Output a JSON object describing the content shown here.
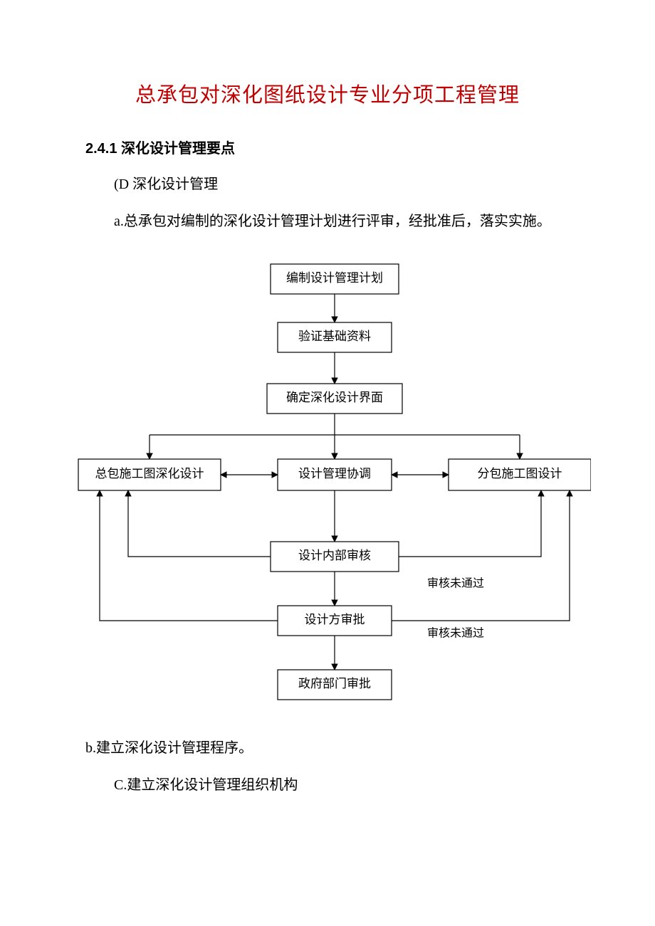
{
  "title": "总承包对深化图纸设计专业分项工程管理",
  "section_heading": "2.4.1 深化设计管理要点",
  "p_d": "(D 深化设计管理",
  "p_a": "a.总承包对编制的深化设计管理计划进行评审，经批准后，落实实施。",
  "p_b": "b.建立深化设计管理程序。",
  "p_c": "C.建立深化设计管理组织机构",
  "chart_data": {
    "type": "flowchart",
    "nodes": {
      "n1": "编制设计管理计划",
      "n2": "验证基础资料",
      "n3": "确定深化设计界面",
      "n4": "总包施工图深化设计",
      "n5": "设计管理协调",
      "n6": "分包施工图设计",
      "n7": "设计内部审核",
      "n8": "设计方审批",
      "n9": "政府部门审批"
    },
    "edge_labels": {
      "fail1": "审核未通过",
      "fail2": "审核未通过"
    },
    "edges": [
      {
        "from": "n1",
        "to": "n2"
      },
      {
        "from": "n2",
        "to": "n3"
      },
      {
        "from": "n3",
        "to": "n4"
      },
      {
        "from": "n3",
        "to": "n5"
      },
      {
        "from": "n3",
        "to": "n6"
      },
      {
        "from": "n5",
        "to": "n4",
        "bidir": true
      },
      {
        "from": "n5",
        "to": "n6",
        "bidir": true
      },
      {
        "from": "n5",
        "to": "n7"
      },
      {
        "from": "n7",
        "to": "n8"
      },
      {
        "from": "n8",
        "to": "n9"
      },
      {
        "from": "n7",
        "to": "n4",
        "label": "fail1_left"
      },
      {
        "from": "n7",
        "to": "n6",
        "label": "fail1_right"
      },
      {
        "from": "n8",
        "to": "n4",
        "label": "fail2_left"
      },
      {
        "from": "n8",
        "to": "n6",
        "label": "fail2_right"
      }
    ]
  }
}
